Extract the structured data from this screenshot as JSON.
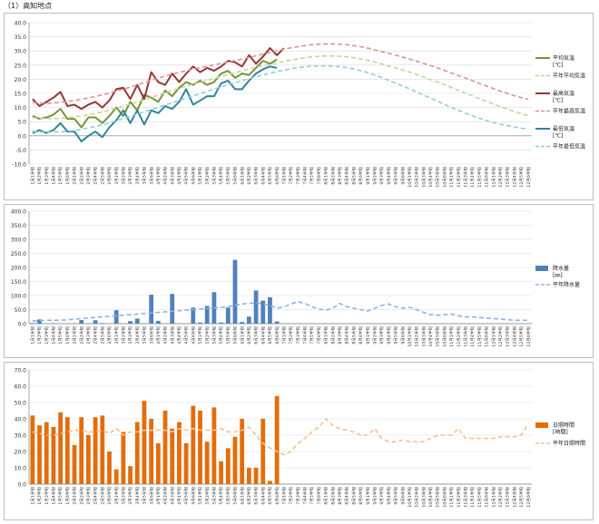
{
  "page_title": "（1）高知地点",
  "colors": {
    "temp_mean": "#77933c",
    "temp_mean_normal": "#c3d69b",
    "temp_max": "#953735",
    "temp_max_normal": "#d99694",
    "temp_min": "#31859c",
    "temp_min_normal": "#93cddd",
    "precip": "#4f81bd",
    "precip_normal": "#8eb4e3",
    "sun": "#e46c0a",
    "sun_normal": "#fac090",
    "grid": "#d9d9d9",
    "axis": "#7f7f7f"
  },
  "chart_data": [
    {
      "type": "line",
      "name": "temperature",
      "categories": [
        "1月1半旬",
        "1月2半旬",
        "1月3半旬",
        "1月4半旬",
        "1月5半旬",
        "1月6半旬",
        "2月1半旬",
        "2月2半旬",
        "2月3半旬",
        "2月4半旬",
        "2月5半旬",
        "2月6半旬",
        "3月1半旬",
        "3月2半旬",
        "3月3半旬",
        "3月4半旬",
        "3月5半旬",
        "3月6半旬",
        "4月1半旬",
        "4月2半旬",
        "4月3半旬",
        "4月4半旬",
        "4月5半旬",
        "4月6半旬",
        "5月1半旬",
        "5月2半旬",
        "5月3半旬",
        "5月4半旬",
        "5月5半旬",
        "5月6半旬",
        "6月1半旬",
        "6月2半旬",
        "6月3半旬",
        "6月4半旬",
        "6月5半旬",
        "6月6半旬",
        "7月1半旬",
        "7月2半旬",
        "7月3半旬",
        "7月4半旬",
        "7月5半旬",
        "7月6半旬",
        "8月1半旬",
        "8月2半旬",
        "8月3半旬",
        "8月4半旬",
        "8月5半旬",
        "8月6半旬",
        "9月1半旬",
        "9月2半旬",
        "9月3半旬",
        "9月4半旬",
        "9月5半旬",
        "9月6半旬",
        "10月1半旬",
        "10月2半旬",
        "10月3半旬",
        "10月4半旬",
        "10月5半旬",
        "10月6半旬",
        "11月1半旬",
        "11月2半旬",
        "11月3半旬",
        "11月4半旬",
        "11月5半旬",
        "11月6半旬",
        "12月1半旬",
        "12月2半旬",
        "12月3半旬",
        "12月4半旬",
        "12月5半旬",
        "12月6半旬"
      ],
      "y_ticks": [
        "-10.0",
        "-5.0",
        "0.0",
        "5.0",
        "10.0",
        "15.0",
        "20.0",
        "25.0",
        "30.0",
        "35.0",
        "40.0"
      ],
      "ylim": [
        -10,
        40
      ],
      "series": [
        {
          "name": "平均気温",
          "unit": "[℃]",
          "style": "solid",
          "color_key": "temp_mean",
          "values": [
            7.0,
            6.0,
            6.5,
            7.5,
            9.5,
            6.0,
            6.0,
            3.0,
            6.5,
            6.5,
            4.5,
            7.0,
            10.0,
            7.0,
            12.0,
            9.0,
            14.5,
            13.5,
            12.0,
            16.0,
            14.0,
            17.0,
            19.0,
            18.0,
            19.5,
            18.0,
            19.0,
            22.0,
            23.0,
            20.5,
            22.0,
            21.5,
            24.0,
            26.5,
            25.5,
            27.0
          ]
        },
        {
          "name": "平年平均気温",
          "style": "dashed",
          "color_key": "temp_mean_normal",
          "values": [
            6.4,
            6.2,
            6.1,
            6.1,
            6.2,
            6.4,
            6.7,
            7.0,
            7.4,
            7.9,
            8.5,
            9.1,
            9.8,
            10.5,
            11.2,
            12.0,
            12.8,
            13.6,
            14.4,
            15.2,
            16.0,
            16.8,
            17.5,
            18.2,
            18.9,
            19.6,
            20.3,
            21.0,
            21.7,
            22.3,
            23.0,
            23.6,
            24.2,
            24.8,
            25.3,
            25.8,
            26.3,
            26.8,
            27.2,
            27.6,
            27.9,
            28.1,
            28.2,
            28.2,
            28.1,
            27.9,
            27.6,
            27.2,
            26.7,
            26.1,
            25.4,
            24.7,
            24.0,
            23.3,
            22.5,
            21.7,
            20.8,
            19.9,
            19.0,
            18.1,
            17.1,
            16.1,
            15.1,
            14.1,
            13.1,
            12.2,
            11.2,
            10.3,
            9.4,
            8.6,
            7.8,
            7.1
          ]
        },
        {
          "name": "最高気温",
          "unit": "[℃]",
          "style": "solid",
          "color_key": "temp_max",
          "values": [
            13.0,
            10.5,
            12.0,
            13.5,
            15.5,
            10.5,
            11.0,
            9.5,
            11.0,
            12.0,
            10.0,
            12.5,
            16.5,
            17.0,
            13.0,
            18.0,
            13.0,
            22.5,
            19.0,
            18.0,
            22.0,
            19.0,
            22.0,
            24.5,
            22.5,
            24.0,
            23.0,
            24.5,
            26.5,
            26.0,
            24.5,
            28.5,
            25.5,
            28.0,
            31.0,
            28.5,
            31.0
          ]
        },
        {
          "name": "平年最高気温",
          "style": "dashed",
          "color_key": "temp_max_normal",
          "values": [
            11.8,
            11.6,
            11.5,
            11.6,
            11.8,
            12.1,
            12.5,
            12.9,
            13.4,
            13.9,
            14.5,
            15.1,
            15.8,
            16.5,
            17.2,
            18.0,
            18.8,
            19.6,
            20.4,
            21.1,
            21.8,
            22.4,
            23.0,
            23.6,
            24.1,
            24.6,
            25.1,
            25.6,
            26.1,
            26.6,
            27.1,
            27.7,
            28.3,
            28.9,
            29.5,
            30.1,
            30.6,
            31.1,
            31.5,
            31.9,
            32.2,
            32.4,
            32.5,
            32.5,
            32.4,
            32.2,
            31.9,
            31.5,
            31.0,
            30.4,
            29.8,
            29.2,
            28.5,
            27.8,
            27.1,
            26.4,
            25.6,
            24.8,
            24.0,
            23.1,
            22.2,
            21.3,
            20.4,
            19.5,
            18.5,
            17.6,
            16.7,
            15.8,
            15.0,
            14.2,
            13.5,
            12.9
          ]
        },
        {
          "name": "最低気温",
          "unit": "[℃]",
          "style": "solid",
          "color_key": "temp_min",
          "values": [
            1.0,
            2.0,
            1.0,
            2.0,
            4.5,
            1.5,
            1.5,
            -2.0,
            0.0,
            1.5,
            -0.5,
            3.0,
            5.5,
            9.0,
            4.5,
            9.0,
            4.0,
            9.0,
            8.0,
            10.5,
            9.5,
            12.0,
            16.5,
            11.0,
            12.5,
            14.0,
            14.0,
            18.5,
            19.5,
            16.5,
            16.5,
            19.5,
            22.0,
            23.5,
            24.5,
            24.0
          ]
        },
        {
          "name": "平年最低気温",
          "style": "dashed",
          "color_key": "temp_min_normal",
          "values": [
            1.6,
            1.4,
            1.3,
            1.3,
            1.4,
            1.6,
            1.9,
            2.3,
            2.8,
            3.3,
            3.9,
            4.6,
            5.3,
            6.1,
            6.9,
            7.7,
            8.5,
            9.3,
            10.1,
            10.9,
            11.7,
            12.5,
            13.3,
            14.1,
            14.9,
            15.7,
            16.5,
            17.3,
            18.1,
            18.8,
            19.5,
            20.2,
            20.9,
            21.5,
            22.1,
            22.7,
            23.2,
            23.7,
            24.1,
            24.4,
            24.6,
            24.7,
            24.7,
            24.6,
            24.4,
            24.1,
            23.6,
            23.0,
            22.3,
            21.5,
            20.6,
            19.6,
            18.6,
            17.6,
            16.6,
            15.5,
            14.4,
            13.3,
            12.2,
            11.1,
            10.0,
            9.0,
            8.0,
            7.1,
            6.2,
            5.4,
            4.7,
            4.1,
            3.6,
            3.1,
            2.7,
            2.4
          ]
        }
      ]
    },
    {
      "type": "bar",
      "name": "precipitation",
      "y_ticks": [
        "0.0",
        "50.0",
        "100.0",
        "150.0",
        "200.0",
        "250.0",
        "300.0",
        "350.0",
        "400.0"
      ],
      "ylim": [
        0,
        400
      ],
      "series": [
        {
          "name": "降水量",
          "unit": "[㎜]",
          "kind": "bar",
          "color_key": "precip",
          "values": [
            2,
            15,
            0,
            1,
            0,
            0,
            1,
            13,
            1,
            12,
            2,
            0,
            48,
            0,
            9,
            18,
            0,
            103,
            10,
            0,
            106,
            0,
            0,
            57,
            4,
            63,
            112,
            4,
            57,
            227,
            6,
            25,
            118,
            82,
            94,
            8
          ]
        },
        {
          "name": "平年降水量",
          "kind": "dashed-line",
          "color_key": "precip_normal",
          "values": [
            10,
            10,
            12,
            12,
            12,
            14,
            16,
            18,
            20,
            22,
            24,
            26,
            28,
            30,
            32,
            34,
            36,
            38,
            40,
            42,
            44,
            46,
            48,
            50,
            52,
            54,
            56,
            58,
            60,
            65,
            70,
            72,
            75,
            70,
            65,
            55,
            60,
            70,
            78,
            72,
            60,
            52,
            48,
            55,
            72,
            60,
            55,
            50,
            45,
            55,
            65,
            70,
            60,
            55,
            58,
            50,
            40,
            32,
            30,
            32,
            34,
            28,
            24,
            24,
            22,
            20,
            18,
            16,
            14,
            12,
            12,
            12
          ]
        }
      ]
    },
    {
      "type": "bar",
      "name": "sunshine",
      "y_ticks": [
        "0.0",
        "10.0",
        "20.0",
        "30.0",
        "40.0",
        "50.0",
        "60.0",
        "70.0"
      ],
      "ylim": [
        0,
        70
      ],
      "series": [
        {
          "name": "日照時間",
          "unit": "[時間]",
          "kind": "bar",
          "color_key": "sun",
          "values": [
            42,
            36,
            38,
            35,
            44,
            41,
            24,
            41,
            30,
            41,
            42,
            20,
            9,
            32,
            11,
            38,
            51,
            40,
            25,
            45,
            34,
            38,
            25,
            48,
            45,
            26,
            47,
            14,
            22,
            29,
            40,
            10,
            10,
            40,
            2,
            54
          ]
        },
        {
          "name": "平年日照時間",
          "kind": "dashed-line",
          "color_key": "sun_normal",
          "values": [
            32,
            31,
            30,
            30,
            31,
            32,
            33,
            33,
            32,
            32,
            33,
            31,
            34,
            30,
            32,
            32,
            33,
            33,
            33,
            33,
            32,
            34,
            33,
            34,
            33,
            33,
            33,
            34,
            32,
            32,
            33,
            35,
            30,
            25,
            22,
            20,
            18,
            20,
            25,
            28,
            32,
            35,
            40,
            36,
            34,
            33,
            32,
            30,
            30,
            34,
            28,
            26,
            26,
            27,
            26,
            26,
            26,
            28,
            30,
            30,
            30,
            34,
            28,
            28,
            28,
            28,
            28,
            29,
            29,
            29,
            30,
            37
          ]
        }
      ]
    }
  ]
}
